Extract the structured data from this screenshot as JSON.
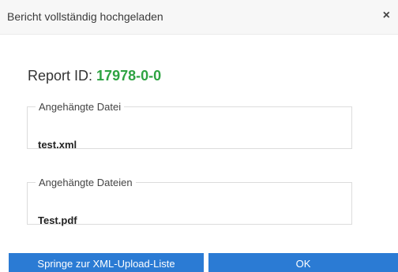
{
  "dialog": {
    "title": "Bericht vollständig hochgeladen",
    "close_symbol": "×"
  },
  "report": {
    "label": "Report ID:",
    "id": "17978-0-0"
  },
  "attachments": [
    {
      "legend": "Angehängte Datei",
      "file": "test.xml"
    },
    {
      "legend": "Angehängte Dateien",
      "file": "Test.pdf"
    }
  ],
  "buttons": {
    "list_label": "Springe zur XML-Upload-Liste",
    "ok_label": "OK"
  },
  "colors": {
    "accent": "#2b7bd4",
    "success": "#2ea342"
  }
}
